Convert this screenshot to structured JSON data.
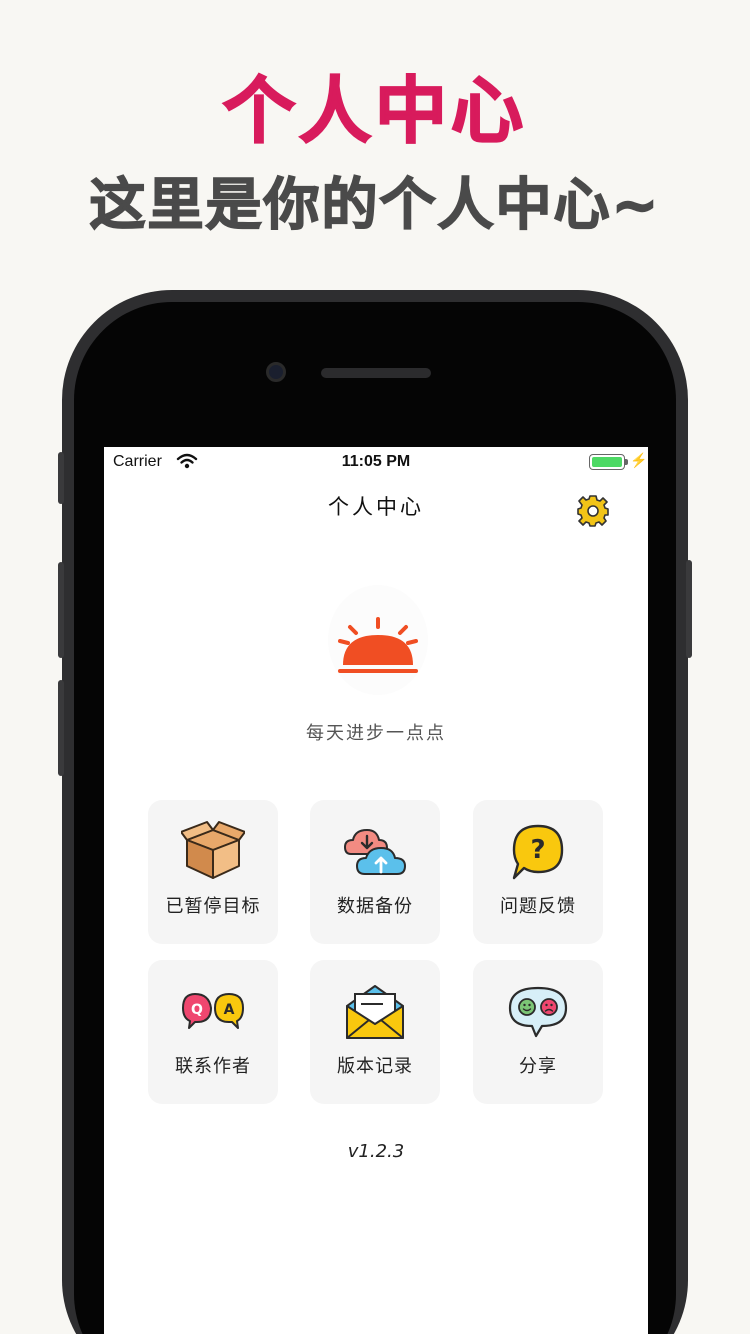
{
  "promo": {
    "title": "个人中心",
    "subtitle": "这里是你的个人中心~"
  },
  "status_bar": {
    "carrier": "Carrier",
    "time": "11:05 PM"
  },
  "nav": {
    "title": "个人中心",
    "settings_icon": "gear-icon"
  },
  "profile": {
    "avatar_icon": "sunrise-icon",
    "slogan": "每天进步一点点"
  },
  "menu": {
    "items": [
      {
        "label": "已暂停目标",
        "icon": "cardboard-box-icon"
      },
      {
        "label": "数据备份",
        "icon": "cloud-sync-icon"
      },
      {
        "label": "问题反馈",
        "icon": "question-bubble-icon"
      },
      {
        "label": "联系作者",
        "icon": "qa-bubbles-icon"
      },
      {
        "label": "版本记录",
        "icon": "open-envelope-icon"
      },
      {
        "label": "分享",
        "icon": "emoji-chat-icon"
      }
    ]
  },
  "version": "v1.2.3",
  "colors": {
    "brand_pink": "#d81b5c",
    "subtitle_gray": "#4a4a4a",
    "accent_orange": "#f04e23",
    "tile_bg": "#f5f5f5",
    "gear_yellow": "#f2c417"
  }
}
